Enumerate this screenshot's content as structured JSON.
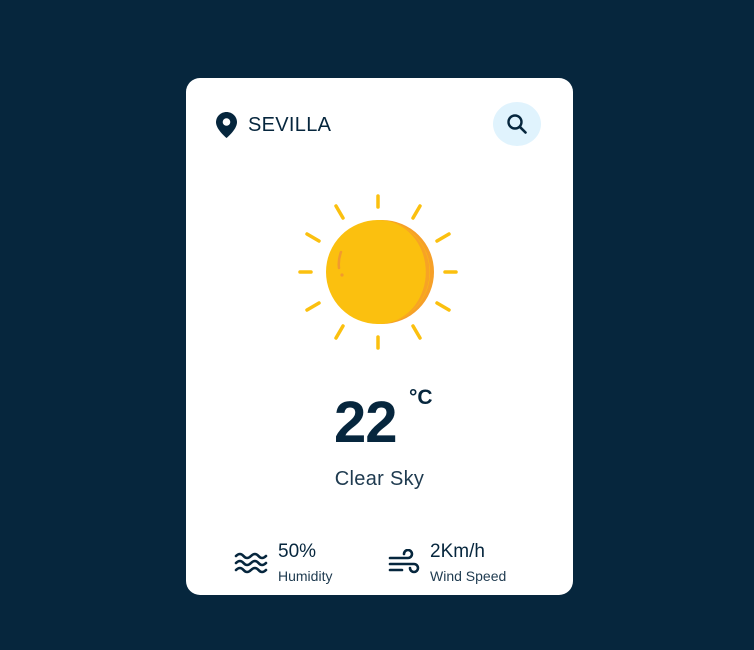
{
  "location": {
    "city": "SEVILLA",
    "icon": "location-pin-icon"
  },
  "search": {
    "icon": "search-icon"
  },
  "weather": {
    "icon": "sun-icon",
    "temperature": "22",
    "unit": "°C",
    "description": "Clear Sky"
  },
  "stats": {
    "humidity": {
      "value": "50%",
      "label": "Humidity",
      "icon": "waves-icon"
    },
    "wind": {
      "value": "2Km/h",
      "label": "Wind Speed",
      "icon": "wind-icon"
    }
  },
  "colors": {
    "background": "#06263d",
    "card": "#ffffff",
    "text": "#06263d",
    "search_bg": "#e0f3fd",
    "sun": "#fbc00f",
    "sun_shadow": "#f6a028"
  }
}
